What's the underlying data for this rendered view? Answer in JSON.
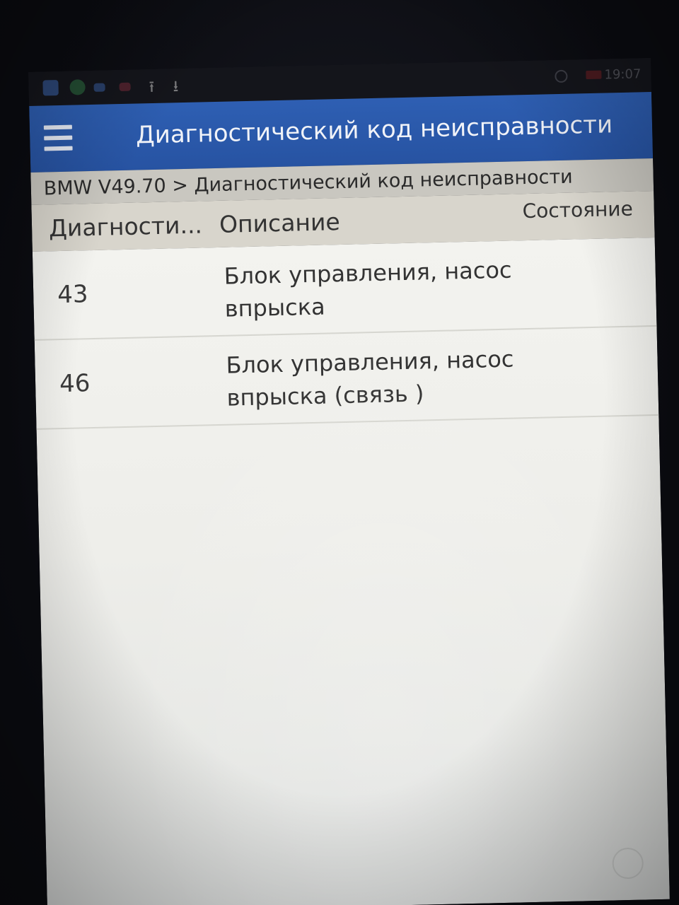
{
  "status_bar": {
    "time": "19:07",
    "icons": [
      "app-icon",
      "browser-icon",
      "message-icon",
      "mail-icon",
      "upload-icon",
      "download-icon",
      "sync-icon",
      "battery-icon"
    ]
  },
  "app_bar": {
    "title": "Диагностический код неисправности",
    "menu_icon": "hamburger-menu-icon"
  },
  "breadcrumb": {
    "text": "BMW V49.70 > Диагностический код неисправности"
  },
  "table": {
    "columns": [
      "Диагности...",
      "Описание",
      "Состояние"
    ],
    "rows": [
      {
        "code": "43",
        "description": "Блок управления, насос впрыска",
        "state": ""
      },
      {
        "code": "46",
        "description": "Блок управления, насос впрыска (связь )",
        "state": ""
      }
    ]
  },
  "colors": {
    "app_bar": "#2e5fb3",
    "breadcrumb_bg": "#c9c7c0",
    "header_bg": "#d8d5cc",
    "body_bg": "#f3f3ef"
  }
}
